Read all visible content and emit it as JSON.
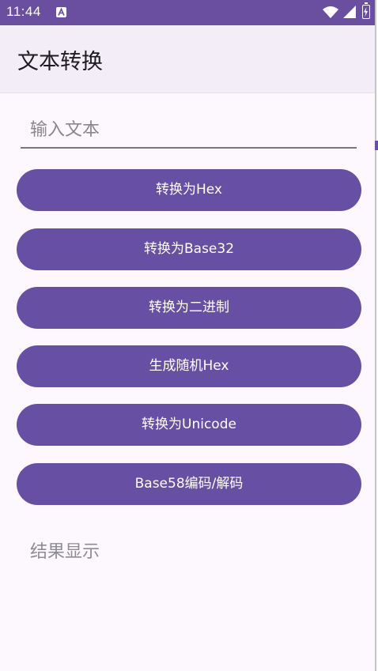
{
  "status_bar": {
    "time": "11:44",
    "icons": [
      "app-notification-icon",
      "wifi-icon",
      "signal-icon",
      "battery-icon"
    ]
  },
  "app_bar": {
    "title": "文本转换"
  },
  "input": {
    "placeholder": "输入文本",
    "value": ""
  },
  "buttons": {
    "to_hex": "转换为Hex",
    "to_base32": "转换为Base32",
    "to_binary": "转换为二进制",
    "random_hex": "生成随机Hex",
    "to_unicode": "转换为Unicode",
    "base58": "Base58编码/解码"
  },
  "result": {
    "text": "结果显示"
  },
  "colors": {
    "status_bar": "#6a4fa0",
    "primary": "#6750a4",
    "app_bar": "#f2edf6",
    "background": "#fdf8fd"
  }
}
